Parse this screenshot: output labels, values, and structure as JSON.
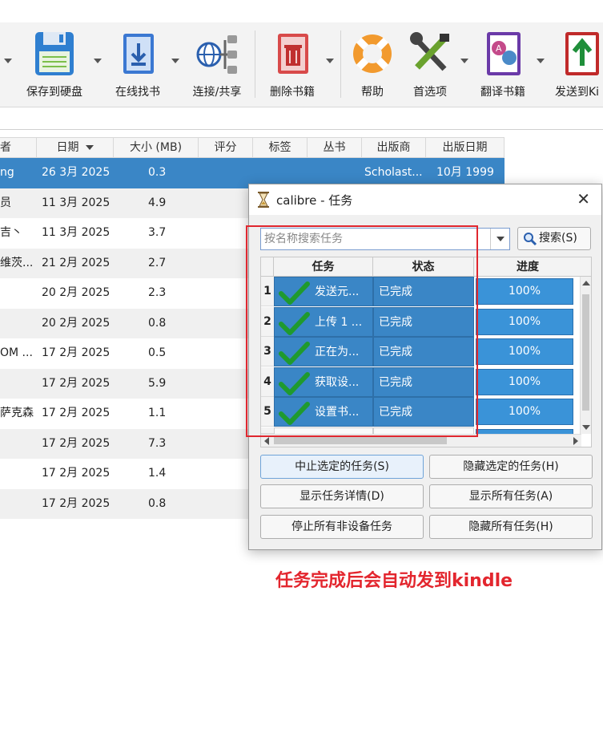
{
  "toolbar": {
    "items": [
      {
        "label": "保存到硬盘",
        "icon": "save-disk-icon"
      },
      {
        "label": "在线找书",
        "icon": "download-book-icon"
      },
      {
        "label": "连接/共享",
        "icon": "connect-share-icon"
      },
      {
        "label": "删除书籍",
        "icon": "delete-book-icon"
      },
      {
        "label": "帮助",
        "icon": "lifebuoy-help-icon"
      },
      {
        "label": "首选项",
        "icon": "tools-preferences-icon"
      },
      {
        "label": "翻译书籍",
        "icon": "translate-icon"
      },
      {
        "label": "发送到Ki",
        "icon": "send-to-kindle-icon"
      }
    ]
  },
  "books": {
    "headers": [
      "者",
      "日期",
      "大小 (MB)",
      "评分",
      "标签",
      "丛书",
      "出版商",
      "出版日期"
    ],
    "rows": [
      {
        "author": "ng",
        "date": "26 3月 2025",
        "size": "0.3",
        "publisher": "Scholast...",
        "pubdate": "10月 1999"
      },
      {
        "author": "员",
        "date": "11 3月 2025",
        "size": "4.9",
        "publisher": "",
        "pubdate": ""
      },
      {
        "author": "吉丶",
        "date": "11 3月 2025",
        "size": "3.7",
        "publisher": "",
        "pubdate": ""
      },
      {
        "author": "维茨...",
        "date": "21 2月 2025",
        "size": "2.7",
        "publisher": "",
        "pubdate": ""
      },
      {
        "author": "",
        "date": "20 2月 2025",
        "size": "2.3",
        "publisher": "",
        "pubdate": ""
      },
      {
        "author": "",
        "date": "20 2月 2025",
        "size": "0.8",
        "publisher": "",
        "pubdate": ""
      },
      {
        "author": "OM ...",
        "date": "17 2月 2025",
        "size": "0.5",
        "publisher": "",
        "pubdate": ""
      },
      {
        "author": "",
        "date": "17 2月 2025",
        "size": "5.9",
        "publisher": "",
        "pubdate": ""
      },
      {
        "author": "萨克森",
        "date": "17 2月 2025",
        "size": "1.1",
        "publisher": "",
        "pubdate": ""
      },
      {
        "author": "",
        "date": "17 2月 2025",
        "size": "7.3",
        "publisher": "",
        "pubdate": ""
      },
      {
        "author": "",
        "date": "17 2月 2025",
        "size": "1.4",
        "publisher": "",
        "pubdate": ""
      },
      {
        "author": "",
        "date": "17 2月 2025",
        "size": "0.8",
        "publisher": "",
        "pubdate": ""
      }
    ]
  },
  "dialog": {
    "title": "calibre - 任务",
    "close": "✕",
    "search_placeholder": "按名称搜索任务",
    "search_button": "搜索(S)",
    "headers": [
      "任务",
      "状态",
      "进度"
    ],
    "jobs": [
      {
        "num": "1",
        "task": "发送元...",
        "status": "已完成",
        "progress": "100%",
        "progress_value": 1.0
      },
      {
        "num": "2",
        "task": "上传 1 ...",
        "status": "已完成",
        "progress": "100%",
        "progress_value": 1.0
      },
      {
        "num": "3",
        "task": "正在为...",
        "status": "已完成",
        "progress": "100%",
        "progress_value": 1.0
      },
      {
        "num": "4",
        "task": "获取设...",
        "status": "已完成",
        "progress": "100%",
        "progress_value": 1.0
      },
      {
        "num": "5",
        "task": "设置书...",
        "status": "已完成",
        "progress": "100%",
        "progress_value": 1.0
      }
    ],
    "buttons": {
      "abort_selected": "中止选定的任务(S)",
      "hide_selected": "隐藏选定的任务(H)",
      "show_details": "显示任务详情(D)",
      "show_all": "显示所有任务(A)",
      "stop_non_device": "停止所有非设备任务",
      "hide_all": "隐藏所有任务(H)"
    }
  },
  "annotation": {
    "note": "任务完成后会自动发到kindle",
    "color": "#e3262e"
  }
}
